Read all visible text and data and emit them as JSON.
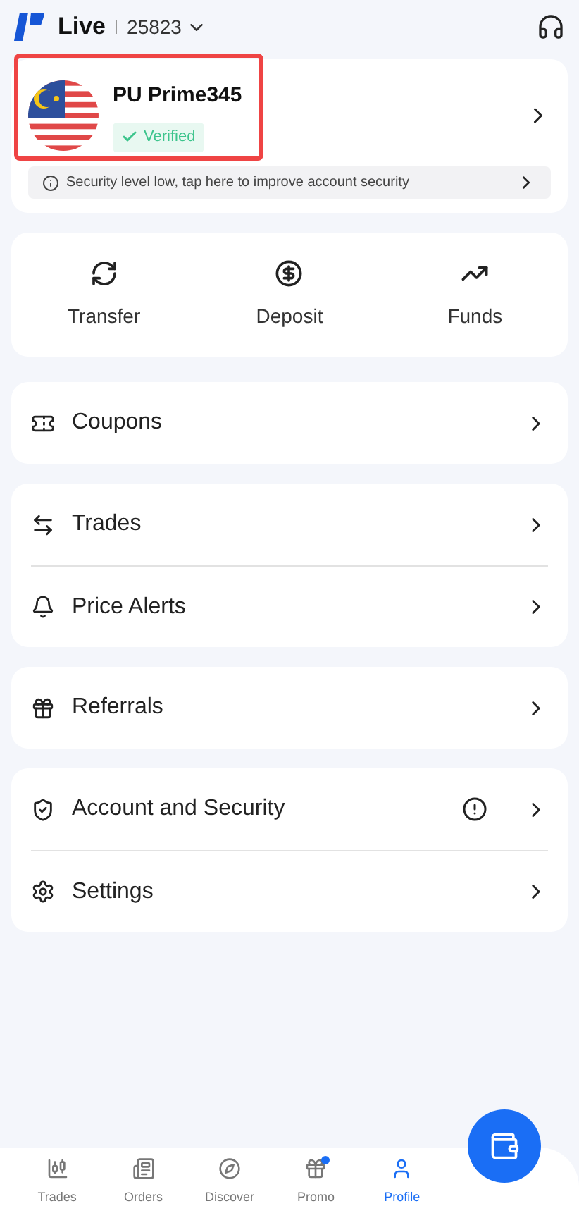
{
  "header": {
    "mode": "Live",
    "account": "25823"
  },
  "profile": {
    "name": "PU Prime345",
    "verified": "Verified",
    "highlighted": true,
    "security_notice": "Security level low, tap here to improve account security"
  },
  "quick_actions": [
    {
      "label": "Transfer"
    },
    {
      "label": "Deposit"
    },
    {
      "label": "Funds"
    }
  ],
  "menu_groups": [
    {
      "items": [
        {
          "label": "Coupons",
          "alert": false
        }
      ]
    },
    {
      "items": [
        {
          "label": "Trades",
          "alert": false
        },
        {
          "label": "Price Alerts",
          "alert": false
        }
      ]
    },
    {
      "items": [
        {
          "label": "Referrals",
          "alert": false
        }
      ]
    },
    {
      "items": [
        {
          "label": "Account and Security",
          "alert": true
        },
        {
          "label": "Settings",
          "alert": false
        }
      ]
    }
  ],
  "bottom_nav": [
    {
      "label": "Trades",
      "selected": false,
      "dot": false
    },
    {
      "label": "Orders",
      "selected": false,
      "dot": false
    },
    {
      "label": "Discover",
      "selected": false,
      "dot": false
    },
    {
      "label": "Promo",
      "selected": false,
      "dot": true
    },
    {
      "label": "Profile",
      "selected": true,
      "dot": false
    }
  ]
}
